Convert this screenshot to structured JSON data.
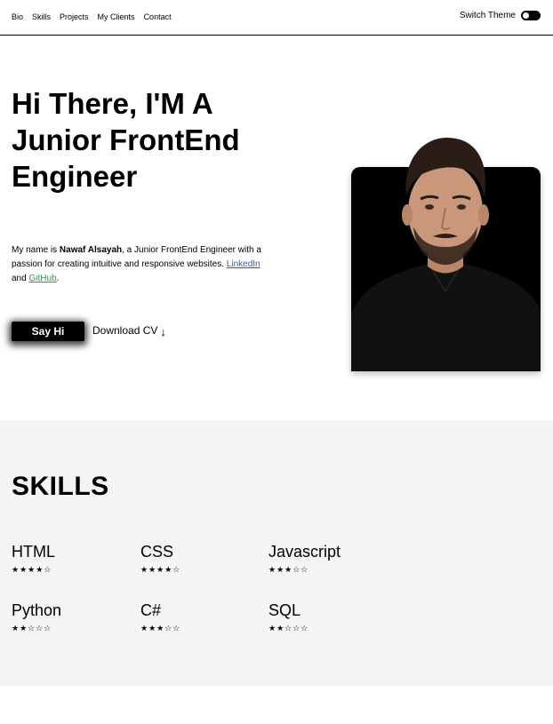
{
  "nav": {
    "links": [
      "Bio",
      "Skills",
      "Projects",
      "My Clients",
      "Contact"
    ],
    "theme_label": "Switch Theme"
  },
  "hero": {
    "title": "Hi There, I'M A Junior FrontEnd Engineer",
    "desc_prefix": "My name is ",
    "name": "Nawaf Alsayah",
    "desc_middle": ", a Junior FrontEnd Engineer with a passion for creating intuitive and responsive websites. ",
    "linkedin": "LinkedIn",
    "and": " and ",
    "github": "GitHub",
    "period": ".",
    "say_hi": "Say Hi",
    "download_cv": "Download CV",
    "download_arrow": "↓"
  },
  "skills": {
    "title": "SKILLS",
    "items": [
      {
        "name": "HTML",
        "stars": "★★★★☆",
        "rating": 4
      },
      {
        "name": "CSS",
        "stars": "★★★★☆",
        "rating": 4
      },
      {
        "name": "Javascript",
        "stars": "★★★☆☆",
        "rating": 3
      },
      {
        "name": "Python",
        "stars": "★★☆☆☆",
        "rating": 2
      },
      {
        "name": "C#",
        "stars": "★★★☆☆",
        "rating": 3
      },
      {
        "name": "SQL",
        "stars": "★★☆☆☆",
        "rating": 2
      }
    ]
  },
  "colors": {
    "linkedin": "#2a5db0",
    "github": "#2e9a44",
    "skills_bg": "#f4f4f4"
  }
}
